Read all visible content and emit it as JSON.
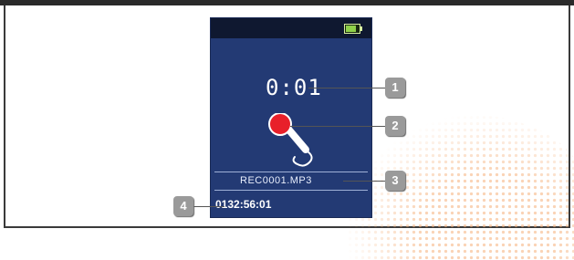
{
  "screen": {
    "battery": {
      "icon": "battery-icon",
      "level": 0.75,
      "color": "#8fd14a"
    },
    "timer": "0:01",
    "mic_icon": "microphone-icon",
    "filename": "REC0001.MP3",
    "remaining": "0132:56:01"
  },
  "callouts": [
    "1",
    "2",
    "3",
    "4"
  ],
  "colors": {
    "screen_bg": "#233a74",
    "status_bg": "#0f1830",
    "mic_red": "#e8202a",
    "badge": "#9a9a9a"
  }
}
